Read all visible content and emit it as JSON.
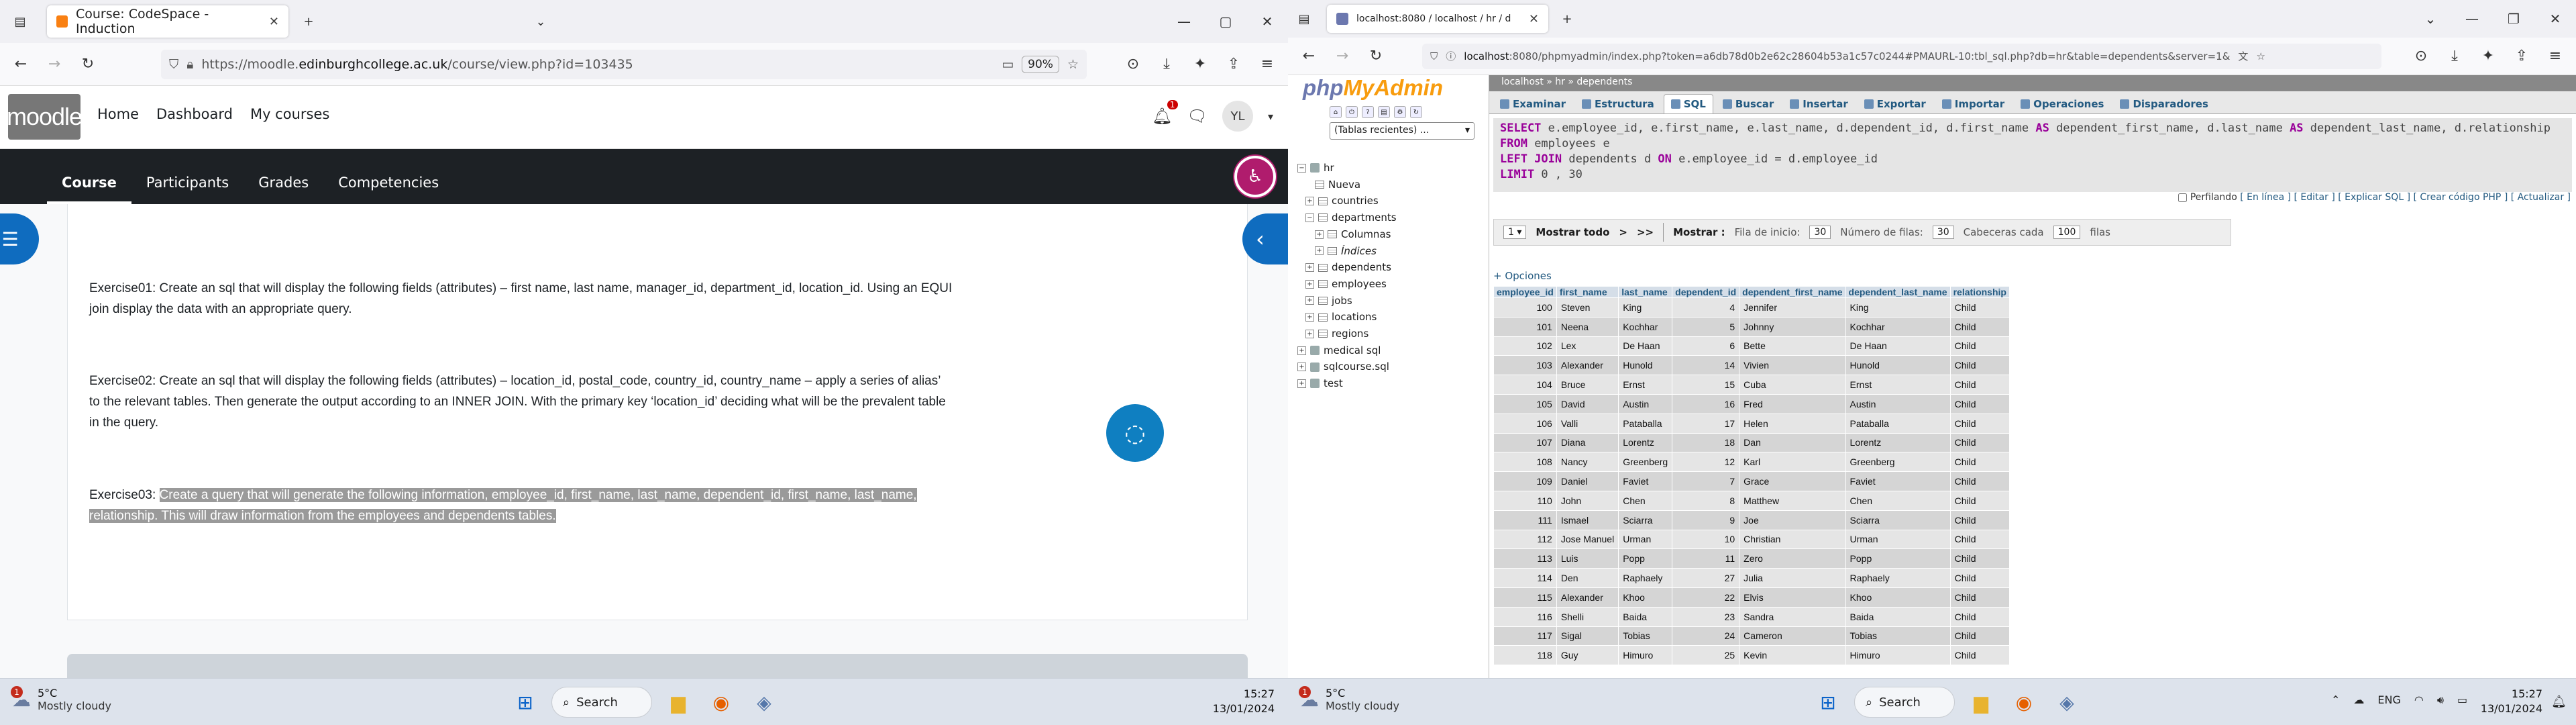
{
  "left": {
    "browser": {
      "tab_title": "Course: CodeSpace - Induction",
      "url_pre": "https://moodle.",
      "url_domain": "edinburghcollege.ac.uk",
      "url_post": "/course/view.php?id=103435",
      "zoom": "90%"
    },
    "moodle": {
      "nav": [
        "Home",
        "Dashboard",
        "My courses"
      ],
      "notif_count": "1",
      "user_initials": "YL",
      "section_tabs": [
        "Course",
        "Participants",
        "Grades",
        "Competencies"
      ],
      "ex1_a": "Exercise01: Create an sql that will display the following fields (attributes) – first name, last name, manager_id, department_id, location_id. Using an EQUI",
      "ex1_b": "join display the data with an appropriate query.",
      "ex2_a": "Exercise02: Create an sql that will display the following fields (attributes) – location_id, postal_code, country_id, country_name – apply a series of alias’",
      "ex2_b": "to the relevant tables. Then generate the output according to an INNER JOIN. With the primary key ‘location_id’ deciding what will be the prevalent table",
      "ex2_c": "in the query.",
      "ex3_lbl": "Exercise03: ",
      "ex3_a": "Create a query that will generate the following information, employee_id, first_name, last_name, dependent_id, first_name, last_name,",
      "ex3_b": "relationship. This will draw information from the employees and dependents tables."
    },
    "taskbar": {
      "temp": "5°C",
      "cond": "Mostly cloudy",
      "search": "Search",
      "time": "15:27",
      "date": "13/01/2024",
      "badge": "1"
    }
  },
  "right": {
    "browser": {
      "tab_title": "localhost:8080 / localhost / hr / d",
      "url_host": "localhost",
      "url_rest": ":8080/phpmyadmin/index.php?token=a6db78d0b2e62c28604b53a1c57c0244#PMAURL-10:tbl_sql.php?db=hr&table=dependents&server=1&"
    },
    "pma": {
      "recent": "(Tablas recientes) ...",
      "tree": {
        "hr": "hr",
        "nueva": "Nueva",
        "countries": "countries",
        "departments": "departments",
        "columnas": "Columnas",
        "indices": "Índices",
        "dependents": "dependents",
        "employees": "employees",
        "jobs": "jobs",
        "locations": "locations",
        "regions": "regions",
        "medical": "medical sql",
        "sqlcourse": "sqlcourse.sql",
        "test": "test"
      },
      "crumb": "localhost »  hr »  dependents",
      "tabs": [
        "Examinar",
        "Estructura",
        "SQL",
        "Buscar",
        "Insertar",
        "Exportar",
        "Importar",
        "Operaciones",
        "Disparadores"
      ],
      "sql": {
        "l1_kw": "SELECT",
        "l1": " e.employee_id, e.first_name, e.last_name, d.dependent_id, d.first_name ",
        "l1_as": "AS",
        "l1b": " dependent_first_name, d.last_name ",
        "l1_as2": "AS",
        "l1c": " dependent_last_name, d.relationship",
        "l2_kw": "FROM",
        "l2": " employees e",
        "l3_kw": "LEFT JOIN",
        "l3": " dependents d ",
        "l3_on": "ON",
        "l3b": " e.employee_id = d.employee_id",
        "l4_kw": "LIMIT",
        "l4": " 0 , 30"
      },
      "profiling": "Perfilando",
      "links": "[ En línea ] [ Editar ] [ Explicar SQL ] [ Crear código PHP ] [ Actualizar ]",
      "nav": {
        "page": "1",
        "show_all": "Mostrar todo",
        "gt": ">",
        "gtgt": ">>",
        "mostrar": "Mostrar :",
        "fila": "Fila de inicio:",
        "fila_v": "30",
        "num": "Número de filas:",
        "num_v": "30",
        "cab": "Cabeceras cada",
        "cab_v": "100",
        "filas": "filas"
      },
      "opciones": "+ Opciones",
      "columns": [
        "employee_id",
        "first_name",
        "last_name",
        "dependent_id",
        "dependent_first_name",
        "dependent_last_name",
        "relationship"
      ],
      "rows": [
        [
          "100",
          "Steven",
          "King",
          "4",
          "Jennifer",
          "King",
          "Child"
        ],
        [
          "101",
          "Neena",
          "Kochhar",
          "5",
          "Johnny",
          "Kochhar",
          "Child"
        ],
        [
          "102",
          "Lex",
          "De Haan",
          "6",
          "Bette",
          "De Haan",
          "Child"
        ],
        [
          "103",
          "Alexander",
          "Hunold",
          "14",
          "Vivien",
          "Hunold",
          "Child"
        ],
        [
          "104",
          "Bruce",
          "Ernst",
          "15",
          "Cuba",
          "Ernst",
          "Child"
        ],
        [
          "105",
          "David",
          "Austin",
          "16",
          "Fred",
          "Austin",
          "Child"
        ],
        [
          "106",
          "Valli",
          "Pataballa",
          "17",
          "Helen",
          "Pataballa",
          "Child"
        ],
        [
          "107",
          "Diana",
          "Lorentz",
          "18",
          "Dan",
          "Lorentz",
          "Child"
        ],
        [
          "108",
          "Nancy",
          "Greenberg",
          "12",
          "Karl",
          "Greenberg",
          "Child"
        ],
        [
          "109",
          "Daniel",
          "Faviet",
          "7",
          "Grace",
          "Faviet",
          "Child"
        ],
        [
          "110",
          "John",
          "Chen",
          "8",
          "Matthew",
          "Chen",
          "Child"
        ],
        [
          "111",
          "Ismael",
          "Sciarra",
          "9",
          "Joe",
          "Sciarra",
          "Child"
        ],
        [
          "112",
          "Jose Manuel",
          "Urman",
          "10",
          "Christian",
          "Urman",
          "Child"
        ],
        [
          "113",
          "Luis",
          "Popp",
          "11",
          "Zero",
          "Popp",
          "Child"
        ],
        [
          "114",
          "Den",
          "Raphaely",
          "27",
          "Julia",
          "Raphaely",
          "Child"
        ],
        [
          "115",
          "Alexander",
          "Khoo",
          "22",
          "Elvis",
          "Khoo",
          "Child"
        ],
        [
          "116",
          "Shelli",
          "Baida",
          "23",
          "Sandra",
          "Baida",
          "Child"
        ],
        [
          "117",
          "Sigal",
          "Tobias",
          "24",
          "Cameron",
          "Tobias",
          "Child"
        ],
        [
          "118",
          "Guy",
          "Himuro",
          "25",
          "Kevin",
          "Himuro",
          "Child"
        ]
      ]
    },
    "taskbar": {
      "temp": "5°C",
      "cond": "Mostly cloudy",
      "search": "Search",
      "lang": "ENG",
      "time": "15:27",
      "date": "13/01/2024",
      "badge": "1"
    }
  }
}
